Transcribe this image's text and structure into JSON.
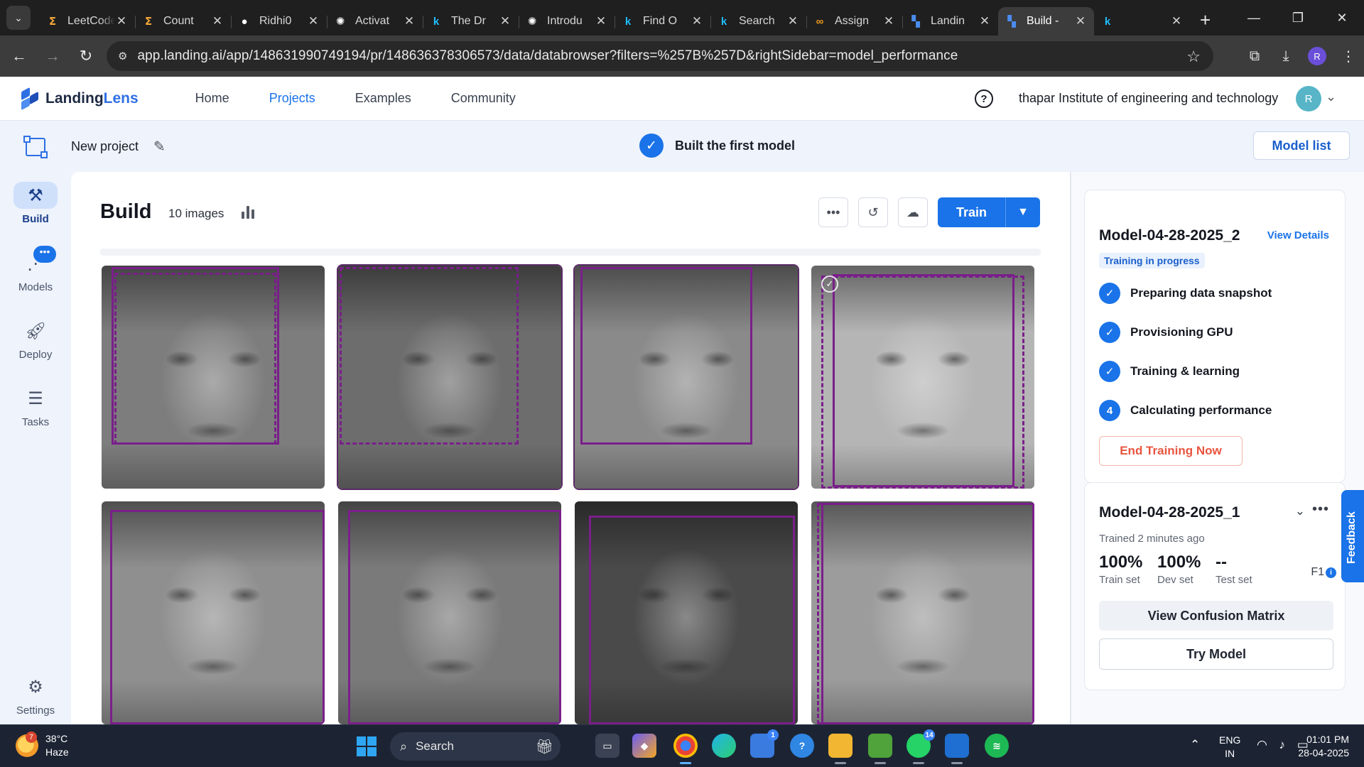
{
  "browser": {
    "tabs": [
      {
        "title": "LeetCode",
        "favicon": "leetcode-icon",
        "color": "#f0a53a",
        "glyph": "ⵉ"
      },
      {
        "title": "Count",
        "favicon": "leetcode-icon",
        "color": "#f0a53a",
        "glyph": "ⵉ"
      },
      {
        "title": "Ridhi0",
        "favicon": "github-icon",
        "color": "#ffffff",
        "glyph": "●"
      },
      {
        "title": "Activat",
        "favicon": "openai-icon",
        "color": "#ffffff",
        "glyph": "✺"
      },
      {
        "title": "The Dr",
        "favicon": "kaggle-icon",
        "color": "#20beff",
        "glyph": "k"
      },
      {
        "title": "Introdu",
        "favicon": "openai-icon",
        "color": "#ffffff",
        "glyph": "✺"
      },
      {
        "title": "Find O",
        "favicon": "kaggle-icon",
        "color": "#20beff",
        "glyph": "k"
      },
      {
        "title": "Search",
        "favicon": "kaggle-icon",
        "color": "#20beff",
        "glyph": "k"
      },
      {
        "title": "Assign",
        "favicon": "colab-icon",
        "color": "#f29c1f",
        "glyph": "∞"
      },
      {
        "title": "Landin",
        "favicon": "landinglens-icon",
        "color": "#4a8cf0",
        "glyph": "▚"
      },
      {
        "title": "Build -",
        "favicon": "landinglens-icon",
        "color": "#4a8cf0",
        "glyph": "▚",
        "active": true
      },
      {
        "title": "",
        "favicon": "kaggle-icon",
        "color": "#20beff",
        "glyph": "k"
      }
    ],
    "url": "app.landing.ai/app/148631990749194/pr/148636378306573/data/databrowser?filters=%257B%257D&rightSidebar=model_performance",
    "profile_initial": "R"
  },
  "app": {
    "logo": {
      "part1": "Landing",
      "part2": "Lens"
    },
    "nav": [
      "Home",
      "Projects",
      "Examples",
      "Community"
    ],
    "active_nav": "Projects",
    "org_name": "thapar Institute of engineering and technology",
    "org_initial": "R"
  },
  "project": {
    "name": "New project",
    "milestone": "Built the first model",
    "model_list_label": "Model list"
  },
  "rail": {
    "build": "Build",
    "models": "Models",
    "deploy": "Deploy",
    "tasks": "Tasks",
    "settings": "Settings",
    "models_badge": "•••"
  },
  "build": {
    "title": "Build",
    "image_count": "10 images",
    "train_label": "Train",
    "more_label": "•••"
  },
  "images": [
    {
      "name": "face-1",
      "tone": "#7d7d7d",
      "selected": false
    },
    {
      "name": "face-2",
      "tone": "#6d6d6d",
      "selected": true
    },
    {
      "name": "face-3",
      "tone": "#8a8a8a",
      "selected": true
    },
    {
      "name": "face-4",
      "tone": "#b5b5b5",
      "selected": false
    },
    {
      "name": "face-5",
      "tone": "#8f8f8f",
      "selected": false
    },
    {
      "name": "face-6",
      "tone": "#7a7a7a",
      "selected": false
    },
    {
      "name": "face-7",
      "tone": "#4a4a4a",
      "selected": false
    },
    {
      "name": "face-8",
      "tone": "#9c9c9c",
      "selected": false
    }
  ],
  "model_training": {
    "name": "Model-04-28-2025_2",
    "view_details": "View Details",
    "status_badge": "Training in progress",
    "steps": [
      {
        "label": "Preparing data snapshot",
        "done": true
      },
      {
        "label": "Provisioning GPU",
        "done": true
      },
      {
        "label": "Training & learning",
        "done": true
      },
      {
        "label": "Calculating performance",
        "done": false,
        "number": "4"
      }
    ],
    "end_label": "End Training Now"
  },
  "model_trained": {
    "name": "Model-04-28-2025_1",
    "trained_ago": "Trained 2 minutes ago",
    "metrics": [
      {
        "value": "100%",
        "label": "Train set"
      },
      {
        "value": "100%",
        "label": "Dev set"
      },
      {
        "value": "--",
        "label": "Test set"
      }
    ],
    "metric_name": "F1",
    "confusion_label": "View Confusion Matrix",
    "try_label": "Try Model"
  },
  "feedback_label": "Feedback",
  "taskbar": {
    "weather_temp": "38°C",
    "weather_desc": "Haze",
    "weather_badge": "7",
    "search_label": "Search",
    "lang_top": "ENG",
    "lang_bottom": "IN",
    "time": "01:01 PM",
    "date": "28-04-2025"
  }
}
